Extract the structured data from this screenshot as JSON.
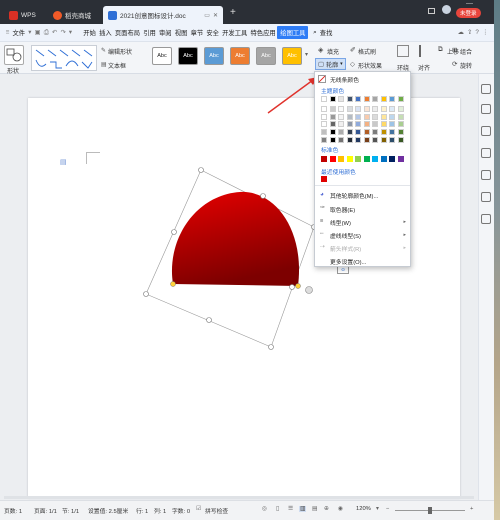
{
  "titlebar": {
    "tabs": [
      {
        "label": "WPS",
        "icon": "wps-logo-icon"
      },
      {
        "label": "稻壳商城",
        "icon": "docer-icon"
      },
      {
        "label": "2021创意图标设计.doc",
        "icon": "word-doc-icon"
      }
    ],
    "new_tab": "+",
    "login_label": "未登录"
  },
  "menubar": {
    "file_label": "文件",
    "items": [
      "开始",
      "插入",
      "页面布局",
      "引用",
      "审阅",
      "视图",
      "章节",
      "安全",
      "开发工具",
      "特色应用"
    ],
    "active_item": "绘图工具",
    "search_label": "查找"
  },
  "ribbon": {
    "shape_label": "形状",
    "edit_shape_label": "编辑形状",
    "textbox_label": "文本框",
    "style_thumbs": [
      "Abc",
      "Abc",
      "Abc",
      "Abc",
      "Abc",
      "Abc"
    ],
    "fill_label": "填充",
    "format_painter_label": "格式刷",
    "outline_label": "轮廓",
    "shape_effect_label": "形状效果",
    "wrap_label": "环绕",
    "align_label": "对齐",
    "group_label": "组合",
    "rotate_label": "旋转",
    "layer_label": "上移"
  },
  "outline_menu": {
    "no_outline": "无线条颜色",
    "theme_colors_label": "主题颜色",
    "standard_colors_label": "标准色",
    "recent_colors_label": "最近使用颜色",
    "more_colors": "其他轮廓颜色(M)...",
    "eyedropper": "取色器(E)",
    "line_weight": "线型(W)",
    "dash_type": "虚线线型(S)",
    "arrow_style": "箭头样式(R)",
    "more_settings": "更多设置(O)...",
    "theme_top_row": [
      "#ffffff",
      "#000000",
      "#e7e6e6",
      "#44546a",
      "#4472c4",
      "#ed7d31",
      "#a5a5a5",
      "#ffc000",
      "#5b9bd5",
      "#70ad47"
    ],
    "standard_colors": [
      "#c00000",
      "#ff0000",
      "#ffc000",
      "#ffff00",
      "#92d050",
      "#00b050",
      "#00b0f0",
      "#0070c0",
      "#002060",
      "#7030a0"
    ],
    "recent_colors": [
      "#e00000"
    ]
  },
  "document": {
    "shape_color": "#d40000",
    "shape_type": "semicircle-arch"
  },
  "statusbar": {
    "words": "页数: 1",
    "page": "页面: 1/1",
    "section": "节: 1/1",
    "position": "设置值: 2.5厘米",
    "row": "行: 1",
    "col": "列: 1",
    "chars": "字数: 0",
    "spell": "拼写检查",
    "zoom": "120%"
  }
}
